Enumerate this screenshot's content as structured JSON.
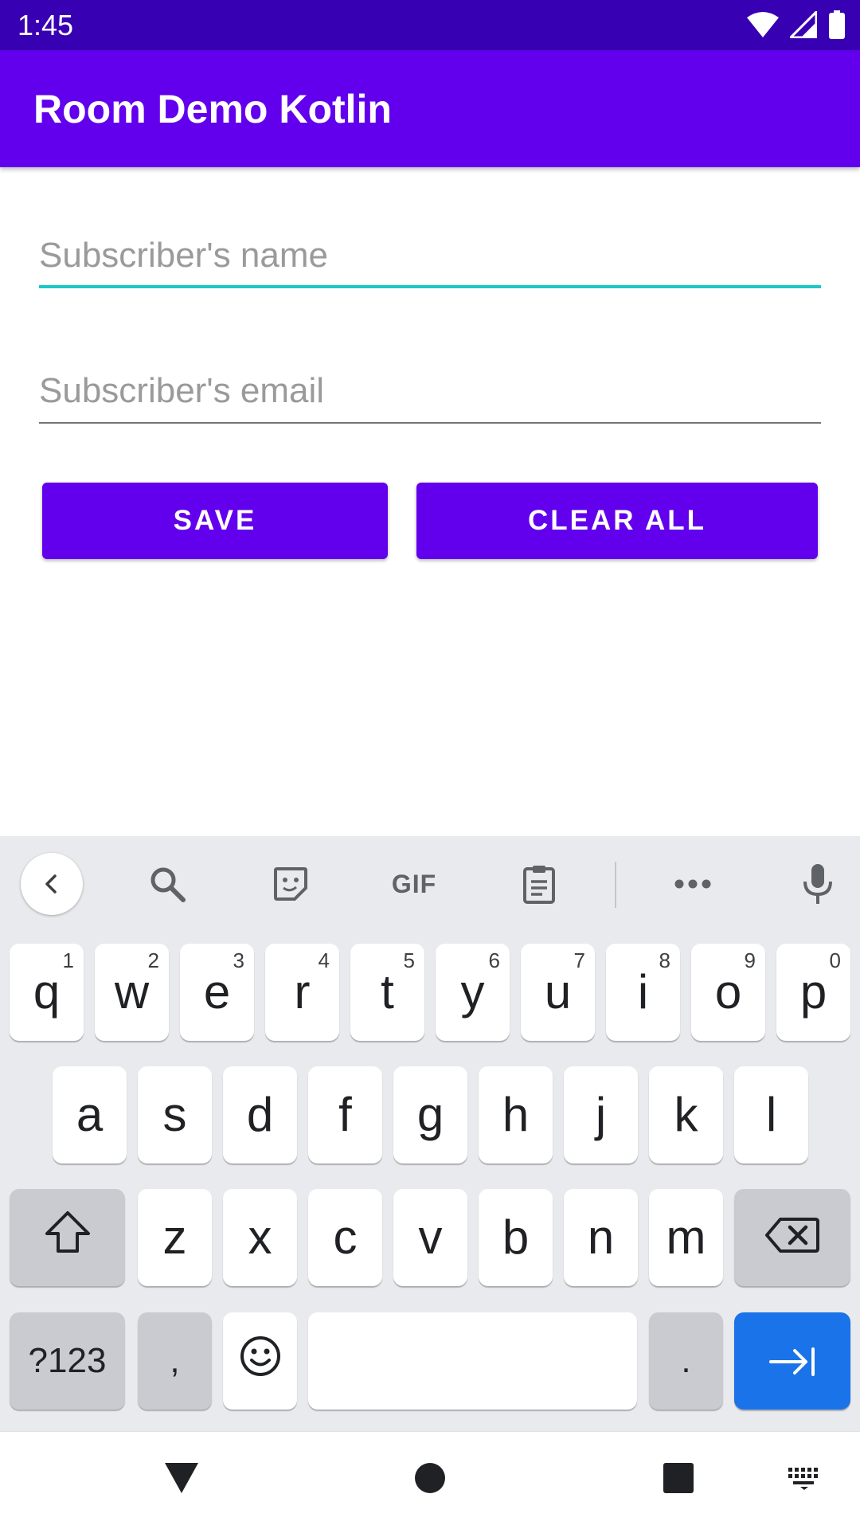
{
  "status_bar": {
    "time": "1:45",
    "icons": [
      "wifi-icon",
      "cellular-signal-icon",
      "battery-icon"
    ]
  },
  "app_bar": {
    "title": "Room Demo Kotlin",
    "color": "#6200ee"
  },
  "form": {
    "name_field": {
      "placeholder": "Subscriber's name",
      "value": "",
      "focused": true
    },
    "email_field": {
      "placeholder": "Subscriber's email",
      "value": ""
    },
    "save_label": "SAVE",
    "clear_all_label": "CLEAR ALL"
  },
  "keyboard": {
    "toolbar": {
      "items": [
        "back-icon",
        "search-icon",
        "sticker-icon",
        "gif",
        "clipboard-icon",
        "more-icon",
        "microphone-icon"
      ],
      "gif_label": "GIF"
    },
    "row1": [
      {
        "key": "q",
        "hint": "1"
      },
      {
        "key": "w",
        "hint": "2"
      },
      {
        "key": "e",
        "hint": "3"
      },
      {
        "key": "r",
        "hint": "4"
      },
      {
        "key": "t",
        "hint": "5"
      },
      {
        "key": "y",
        "hint": "6"
      },
      {
        "key": "u",
        "hint": "7"
      },
      {
        "key": "i",
        "hint": "8"
      },
      {
        "key": "o",
        "hint": "9"
      },
      {
        "key": "p",
        "hint": "0"
      }
    ],
    "row2": [
      "a",
      "s",
      "d",
      "f",
      "g",
      "h",
      "j",
      "k",
      "l"
    ],
    "row3": [
      "z",
      "x",
      "c",
      "v",
      "b",
      "n",
      "m"
    ],
    "row4": {
      "symbols_label": "?123",
      "comma": ",",
      "period": "."
    },
    "action_color": "#1a73e8"
  },
  "nav_bar": {
    "items": [
      "back-triangle-icon",
      "home-circle-icon",
      "recents-square-icon",
      "keyboard-switch-icon"
    ]
  }
}
